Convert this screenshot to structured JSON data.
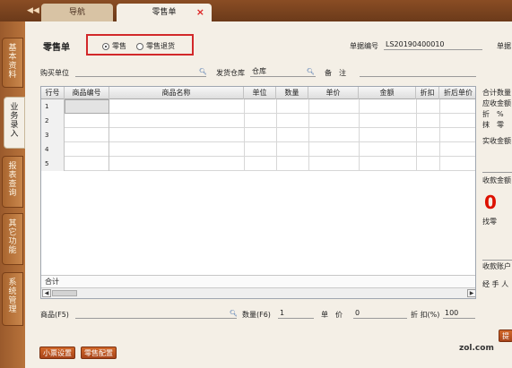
{
  "tabs": {
    "nav_label": "导航",
    "retail_label": "零售单",
    "close_glyph": "×",
    "back_glyph": "◀◀"
  },
  "leftnav": [
    {
      "label": "基本资料"
    },
    {
      "label": "业务录入"
    },
    {
      "label": "报表查询"
    },
    {
      "label": "其它功能"
    },
    {
      "label": "系统管理"
    }
  ],
  "header": {
    "title": "零售单",
    "mode_options": [
      "零售",
      "零售退货"
    ],
    "mode_selected": "零售",
    "doc_no_label": "单据编号",
    "doc_no_value": "LS20190400010",
    "doc_date_label": "单据"
  },
  "form": {
    "buyer_label": "购买单位",
    "buyer_value": "",
    "warehouse_label": "发货仓库",
    "warehouse_value": "仓库",
    "remark_label": "备　注",
    "remark_value": ""
  },
  "grid": {
    "columns": [
      "行号",
      "商品编号",
      "商品名称",
      "单位",
      "数量",
      "单价",
      "金额",
      "折扣",
      "折后单价"
    ],
    "row_numbers": [
      "1",
      "2",
      "3",
      "4",
      "5"
    ],
    "sum_label": "合计"
  },
  "summary": {
    "total_qty": "合计数量",
    "receivable": "应收金额",
    "discount": "折　%",
    "round": "抹　零",
    "actual": "实收金额",
    "received": "收款金额",
    "received_value": "0",
    "change": "找零",
    "account": "收款账户",
    "handler": "经 手 人"
  },
  "footer": {
    "product_label": "商品(F5)",
    "qty_label": "数量(F6)",
    "qty_value": "1",
    "unit_label": "单　价",
    "unit_value": "0",
    "disc_label": "折 扣(%)",
    "disc_value": "100",
    "btn_receipt": "小票设置",
    "btn_print": "零售配置",
    "btn_right": "提",
    "watermark": "zol.com"
  },
  "colors": {
    "accent": "#d2282a",
    "brand": "#b8733b"
  }
}
